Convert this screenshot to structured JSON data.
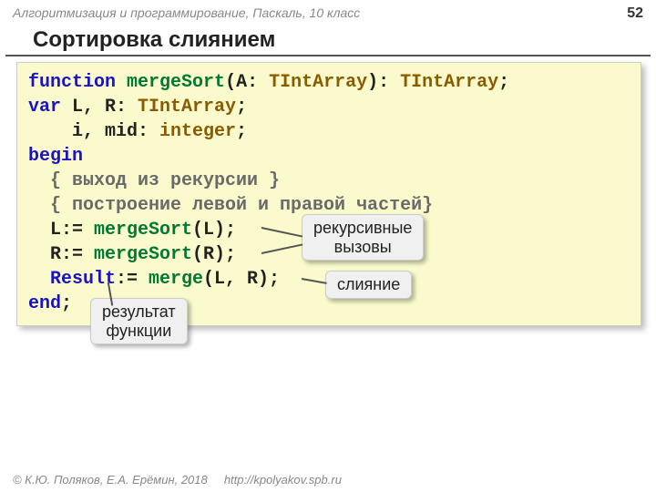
{
  "header": {
    "course": "Алгоритмизация и программирование, Паскаль, 10 класс",
    "page": "52"
  },
  "title": "Сортировка слиянием",
  "code": {
    "l1": {
      "kw1": "function",
      "fn": "mergeSort",
      "p1": "(A: ",
      "typ1": "TIntArray",
      "p2": "): ",
      "typ2": "TIntArray",
      "p3": ";"
    },
    "l2": {
      "kw1": "var",
      "txt1": " L, R: ",
      "typ1": "TIntArray",
      "p1": ";"
    },
    "l3": {
      "txt1": "    i, mid: ",
      "typ1": "integer",
      "p1": ";"
    },
    "l4": {
      "kw1": "begin"
    },
    "l5": {
      "cmt": "  { выход из рекурсии }"
    },
    "l6": {
      "cmt": "  { построение левой и правой частей}"
    },
    "l7": {
      "txt1": "  L:= ",
      "fn": "mergeSort",
      "txt2": "(L);"
    },
    "l8": {
      "txt1": "  R:= ",
      "fn": "mergeSort",
      "txt2": "(R);"
    },
    "l9": {
      "id": "  Result",
      "txt1": ":= ",
      "fn": "merge",
      "txt2": "(L, R);"
    },
    "l10": {
      "kw1": "end",
      "p1": ";"
    }
  },
  "callouts": {
    "recursive": "рекурсивные\nвызовы",
    "merge": "слияние",
    "result": "результат\nфункции"
  },
  "footer": {
    "copyright": "© К.Ю. Поляков, Е.А. Ерёмин, 2018",
    "url": "http://kpolyakov.spb.ru"
  }
}
